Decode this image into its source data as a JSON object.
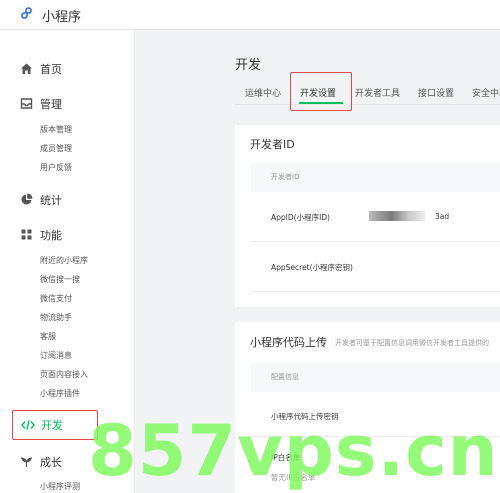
{
  "app": {
    "title": "小程序"
  },
  "colors": {
    "accent": "#07c160",
    "highlight": "#e0484a",
    "watermark": "#7cfa5c"
  },
  "sidebar": {
    "home": {
      "label": "首页",
      "icon": "home-icon"
    },
    "manage": {
      "label": "管理",
      "icon": "inbox-icon",
      "items": [
        "版本管理",
        "成员管理",
        "用户反馈"
      ]
    },
    "stats": {
      "label": "统计",
      "icon": "pie-chart-icon"
    },
    "features": {
      "label": "功能",
      "icon": "grid-icon",
      "items": [
        "附近的小程序",
        "微信搜一搜",
        "微信支付",
        "物流助手",
        "客服",
        "订阅消息",
        "页面内容接入",
        "小程序插件"
      ]
    },
    "dev": {
      "label": "开发",
      "icon": "code-icon"
    },
    "growth": {
      "label": "成长",
      "icon": "sprout-icon",
      "items": [
        "小程序评测"
      ]
    }
  },
  "main": {
    "page_title": "开发",
    "tabs": [
      "运维中心",
      "开发设置",
      "开发者工具",
      "接口设置",
      "安全中心"
    ],
    "active_tab": "开发设置",
    "developer_id": {
      "title": "开发者ID",
      "header": "开发者ID",
      "appid_label": "AppID(小程序ID)",
      "appid_value_suffix": "3ad",
      "appsecret_label": "AppSecret(小程序密钥)"
    },
    "upload": {
      "title": "小程序代码上传",
      "desc": "开发者可基于配置信息调用微信开发者工具提供的",
      "header": "配置信息",
      "key_label": "小程序代码上传密钥",
      "ip_label": "IP白名单",
      "ip_empty": "暂无IP白名单"
    }
  },
  "watermark": {
    "text": "857vps.cn"
  }
}
